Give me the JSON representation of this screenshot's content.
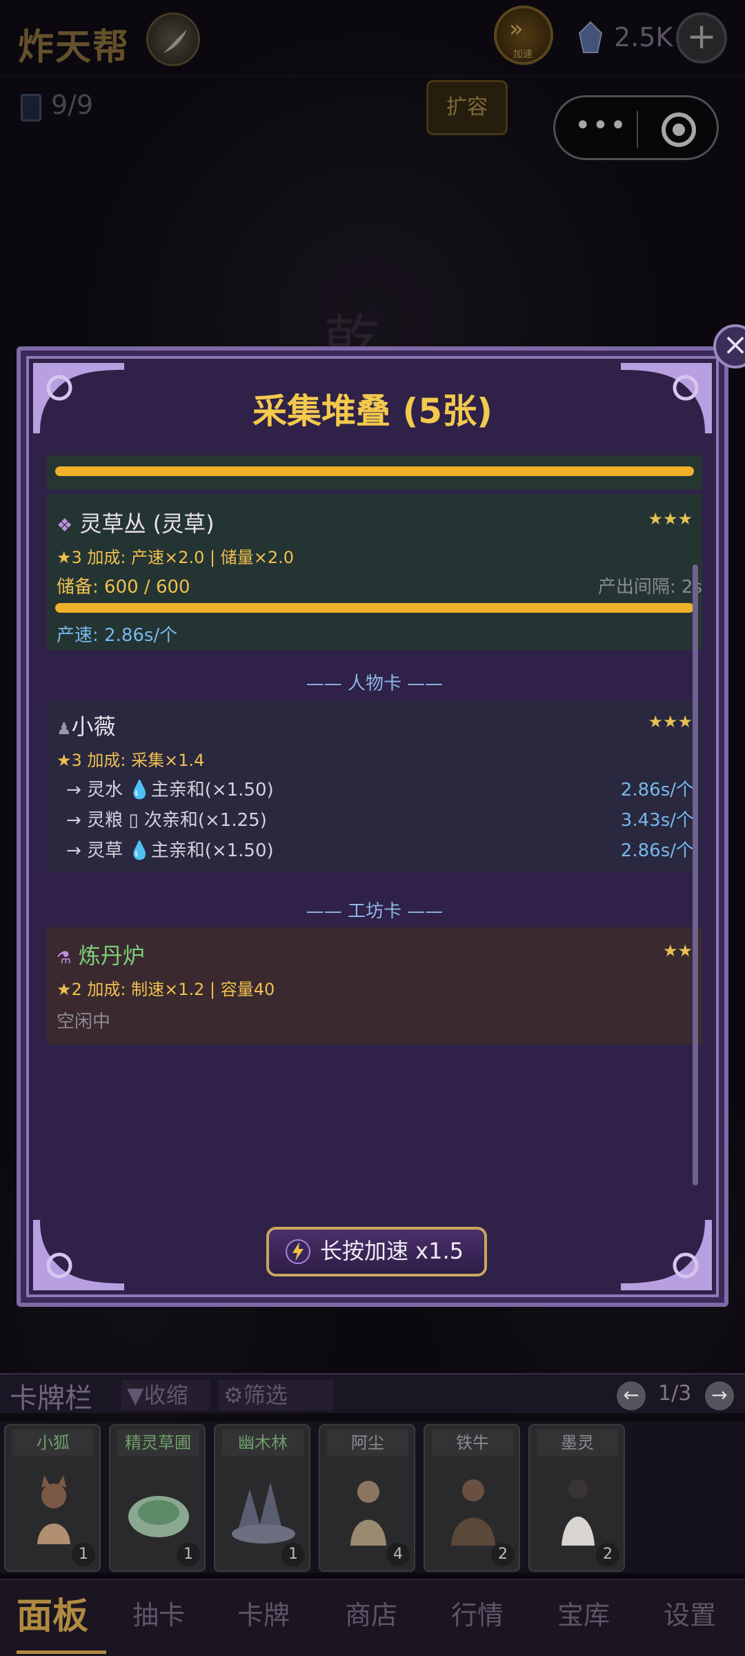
{
  "header": {
    "title": "炸天帮",
    "speed_label": "加速",
    "gem_count": "2.5K",
    "plus": "+"
  },
  "subbar": {
    "card_count": "9/9",
    "expand_label": "扩容"
  },
  "modal": {
    "title": "采集堆叠 (5张)",
    "close": "×",
    "herb": {
      "name": "灵草丛 (灵草)",
      "stars": "★★★",
      "bonus": "★3 加成: 产速×2.0 | 储量×2.0",
      "storage": "储备: 600 / 600",
      "interval": "产出间隔: 2s",
      "storage_fill": 1.0,
      "rate": "产速: 2.86s/个"
    },
    "character_divider": "—— 人物卡 ——",
    "character": {
      "name": "小薇",
      "stars": "★★★",
      "bonus": "★3 加成: 采集×1.4",
      "links": [
        {
          "text": "→ 灵水 💧主亲和(×1.50)",
          "value": "2.86s/个"
        },
        {
          "text": "→ 灵粮 ▯ 次亲和(×1.25)",
          "value": "3.43s/个"
        },
        {
          "text": "→ 灵草 💧主亲和(×1.50)",
          "value": "2.86s/个"
        }
      ]
    },
    "workshop_divider": "—— 工坊卡 ——",
    "workshop": {
      "name": "炼丹炉",
      "stars": "★★",
      "bonus": "★2 加成: 制速×1.2 | 容量40",
      "status": "空闲中"
    },
    "hold_button": "长按加速 x1.5"
  },
  "cardbar": {
    "title": "卡牌栏",
    "collapse": "▼收缩",
    "filter": "筛选",
    "page": "1/3",
    "cards": [
      {
        "name": "小狐",
        "count": "1"
      },
      {
        "name": "精灵草圃",
        "count": "1"
      },
      {
        "name": "幽木林",
        "count": "1"
      },
      {
        "name": "阿尘",
        "count": "4"
      },
      {
        "name": "铁牛",
        "count": "2"
      },
      {
        "name": "墨灵",
        "count": "2"
      }
    ]
  },
  "nav": {
    "items": [
      "面板",
      "抽卡",
      "卡牌",
      "商店",
      "行情",
      "宝库",
      "设置"
    ]
  },
  "capsule": {
    "dots": "•••"
  }
}
